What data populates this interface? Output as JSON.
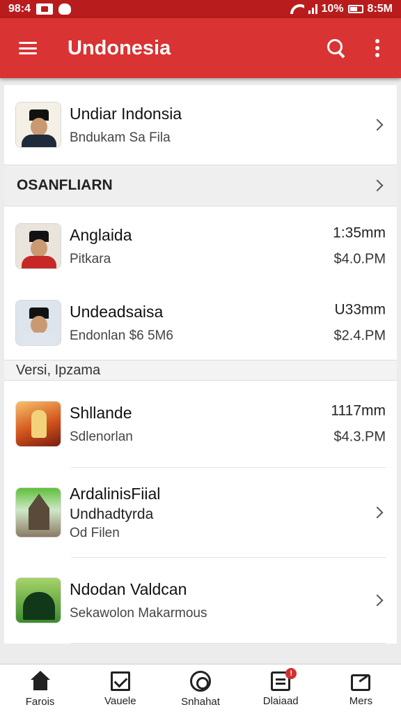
{
  "status_bar": {
    "left_time": "98:4",
    "battery_percent": "10%",
    "right_time": "8:5M"
  },
  "app_bar": {
    "title": "Undonesia"
  },
  "header_item": {
    "title": "Undiar Indonsia",
    "subtitle": "Bndukam Sa Fila"
  },
  "section1": {
    "heading": "OSANFLIARN"
  },
  "list1": [
    {
      "title": "Anglaida",
      "subtitle": "Pitkara",
      "time": "1:35mm",
      "price": "$4.0.PM"
    },
    {
      "title": "Undeadsaisa",
      "subtitle": "Endonlan $6 5M6",
      "time": "U33mm",
      "price": "$2.4.PM"
    }
  ],
  "section2": {
    "heading": "Versi, Ipzama"
  },
  "list2_top": {
    "title": "Shllande",
    "subtitle": "Sdlenorlan",
    "time": "1117mm",
    "price": "$4.3.PM"
  },
  "list2_mid": {
    "title": "ArdalinisFiial",
    "line2": "Undhadtyrda",
    "line3": "Od Filen"
  },
  "list2_bot": {
    "title": "Ndodan Valdcan",
    "subtitle": "Sekawolon Makarmous"
  },
  "bottom_nav": [
    {
      "label": "Farois",
      "icon": "home-icon"
    },
    {
      "label": "Vauele",
      "icon": "checkbox-icon"
    },
    {
      "label": "Snhahat",
      "icon": "target-icon"
    },
    {
      "label": "Dlaiaad",
      "icon": "document-icon",
      "badge": "!"
    },
    {
      "label": "Mers",
      "icon": "share-icon"
    }
  ],
  "colors": {
    "status_bar": "#b91c1c",
    "app_bar": "#d93333"
  }
}
